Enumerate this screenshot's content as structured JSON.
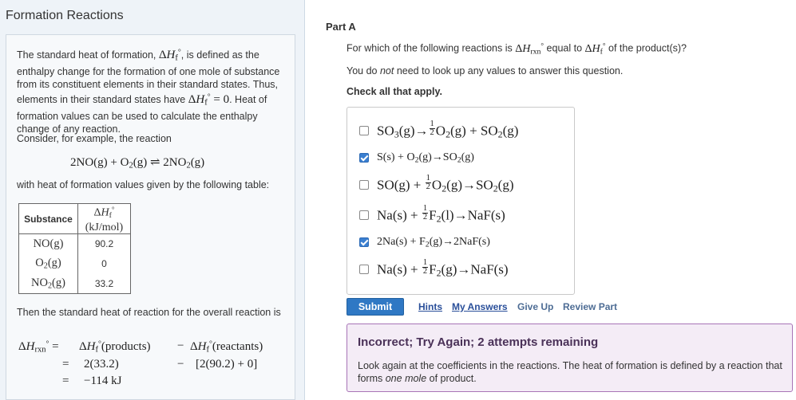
{
  "left": {
    "title": "Formation Reactions",
    "def_part1": "The standard heat of formation, ",
    "def_part2": ", is defined as the enthalpy change for the formation of one mole of substance from its constituent elements in their standard states. Thus, elements in their standard states have ",
    "def_part3": ". Heat of formation values can be used to calculate the enthalpy change of any reaction.",
    "consider": "Consider, for example, the reaction",
    "with_table": "with heat of formation values given by the following table:",
    "table": {
      "header_substance": "Substance",
      "rows": [
        {
          "value": "90.2"
        },
        {
          "value": "0"
        },
        {
          "value": "33.2"
        }
      ]
    },
    "then": "Then the standard heat of reaction for the overall reaction is",
    "deriv": {
      "products": "(products)",
      "minus": "−",
      "reactants": "(reactants)",
      "line2_products": "2(33.2)",
      "line2_reactants": "[2(90.2) + 0]",
      "line3": "−114 kJ"
    }
  },
  "right": {
    "part_label": "Part A",
    "question_pre": "For which of the following reactions is ",
    "question_mid": " equal to ",
    "question_post": " of the product(s)?",
    "note_pre": "You do ",
    "note_em": "not",
    "note_post": " need to look up any values to answer this question.",
    "check_all": "Check all that apply.",
    "options": [
      {
        "checked": false
      },
      {
        "checked": true
      },
      {
        "checked": false
      },
      {
        "checked": false
      },
      {
        "checked": true
      },
      {
        "checked": false
      }
    ],
    "submit": "Submit",
    "hints": "Hints",
    "my_answers": "My Answers",
    "give_up": "Give Up",
    "review_part": "Review Part",
    "feedback_title": "Incorrect; Try Again; 2 attempts remaining",
    "feedback_pre": "Look again at the coefficients in the reactions. The heat of formation is defined by a reaction that forms ",
    "feedback_em": "one mole",
    "feedback_post": " of product."
  },
  "colors": {
    "left_bg": "#eef3f8",
    "submit_bg": "#2f78c4",
    "checkbox_checked": "#3b7fd0",
    "feedback_bg": "#f4ecf6",
    "feedback_border": "#a874b6",
    "link": "#2a4f9a"
  }
}
